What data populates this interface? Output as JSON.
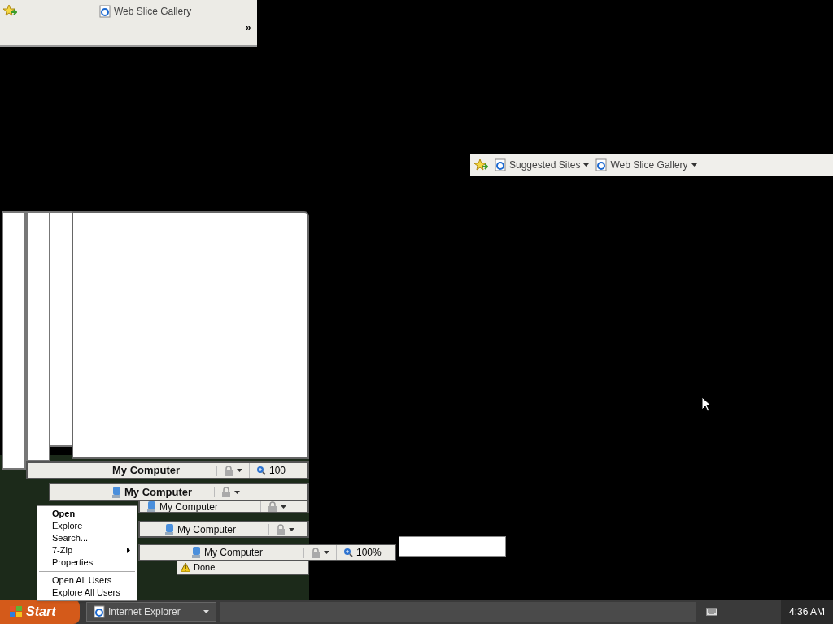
{
  "top_toolbar": {
    "links": [
      {
        "label": "Web Slice Gallery"
      }
    ],
    "chevron": "»"
  },
  "favorites_bar": {
    "links": [
      {
        "label": "Suggested Sites"
      },
      {
        "label": "Web Slice Gallery"
      }
    ]
  },
  "status_bars": [
    {
      "title": "My Computer",
      "bold": true,
      "icon": false,
      "zoom": "100"
    },
    {
      "title": "My Computer",
      "bold": true,
      "icon": true
    },
    {
      "title": "My Computer",
      "bold": false,
      "icon": true
    },
    {
      "title": "My Computer",
      "bold": false,
      "icon": true
    },
    {
      "title": "My Computer",
      "bold": false,
      "icon": true,
      "zoom": "100%"
    }
  ],
  "done_bar": {
    "text": "Done"
  },
  "context_menu": {
    "items": [
      {
        "kind": "default",
        "label": "Open"
      },
      {
        "kind": "item",
        "label": "Explore"
      },
      {
        "kind": "item",
        "label": "Search..."
      },
      {
        "kind": "submenu",
        "label": "7-Zip"
      },
      {
        "kind": "item",
        "label": "Properties"
      },
      {
        "kind": "separator"
      },
      {
        "kind": "item",
        "label": "Open All Users"
      },
      {
        "kind": "item",
        "label": "Explore All Users"
      }
    ]
  },
  "taskbar": {
    "start": "Start",
    "tasks": [
      {
        "label": "Internet Explorer"
      }
    ],
    "clock": "4:36 AM"
  }
}
